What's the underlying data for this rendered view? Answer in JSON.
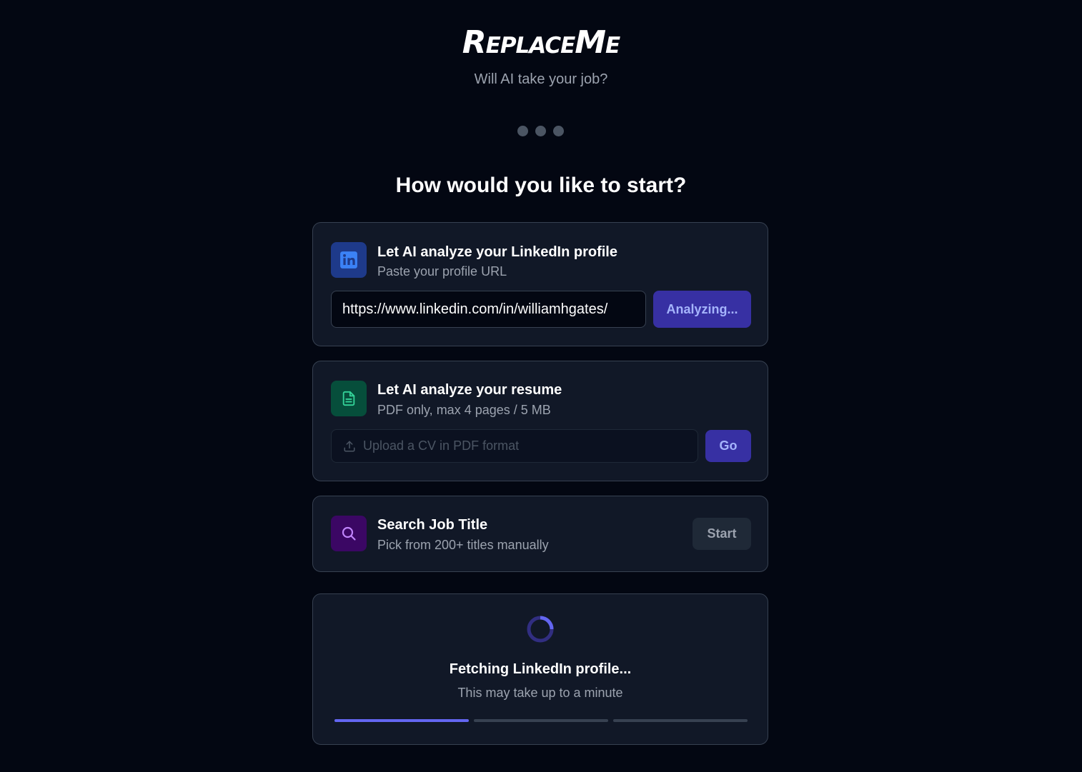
{
  "brand": {
    "logo_text": "ReplaceMe",
    "tagline": "Will AI take your job?"
  },
  "steps": {
    "total": 3
  },
  "heading": "How would you like to start?",
  "linkedin": {
    "title": "Let AI analyze your LinkedIn profile",
    "subtitle": "Paste your profile URL",
    "url_value": "https://www.linkedin.com/in/williamhgates/",
    "button_label": "Analyzing...",
    "icon": "linkedin-icon"
  },
  "resume": {
    "title": "Let AI analyze your resume",
    "subtitle": "PDF only, max 4 pages / 5 MB",
    "upload_placeholder": "Upload a CV in PDF format",
    "button_label": "Go",
    "icon": "document-icon"
  },
  "search": {
    "title": "Search Job Title",
    "subtitle": "Pick from 200+ titles manually",
    "button_label": "Start",
    "icon": "search-icon"
  },
  "loading": {
    "title": "Fetching LinkedIn profile...",
    "subtitle": "This may take up to a minute",
    "progress_steps_total": 3,
    "progress_steps_done": 1
  },
  "colors": {
    "background": "#030712",
    "card": "#111827",
    "accent": "#6366f1",
    "linkedin": "#1e3a8a",
    "resume": "#064e3b",
    "search": "#3b0764"
  }
}
